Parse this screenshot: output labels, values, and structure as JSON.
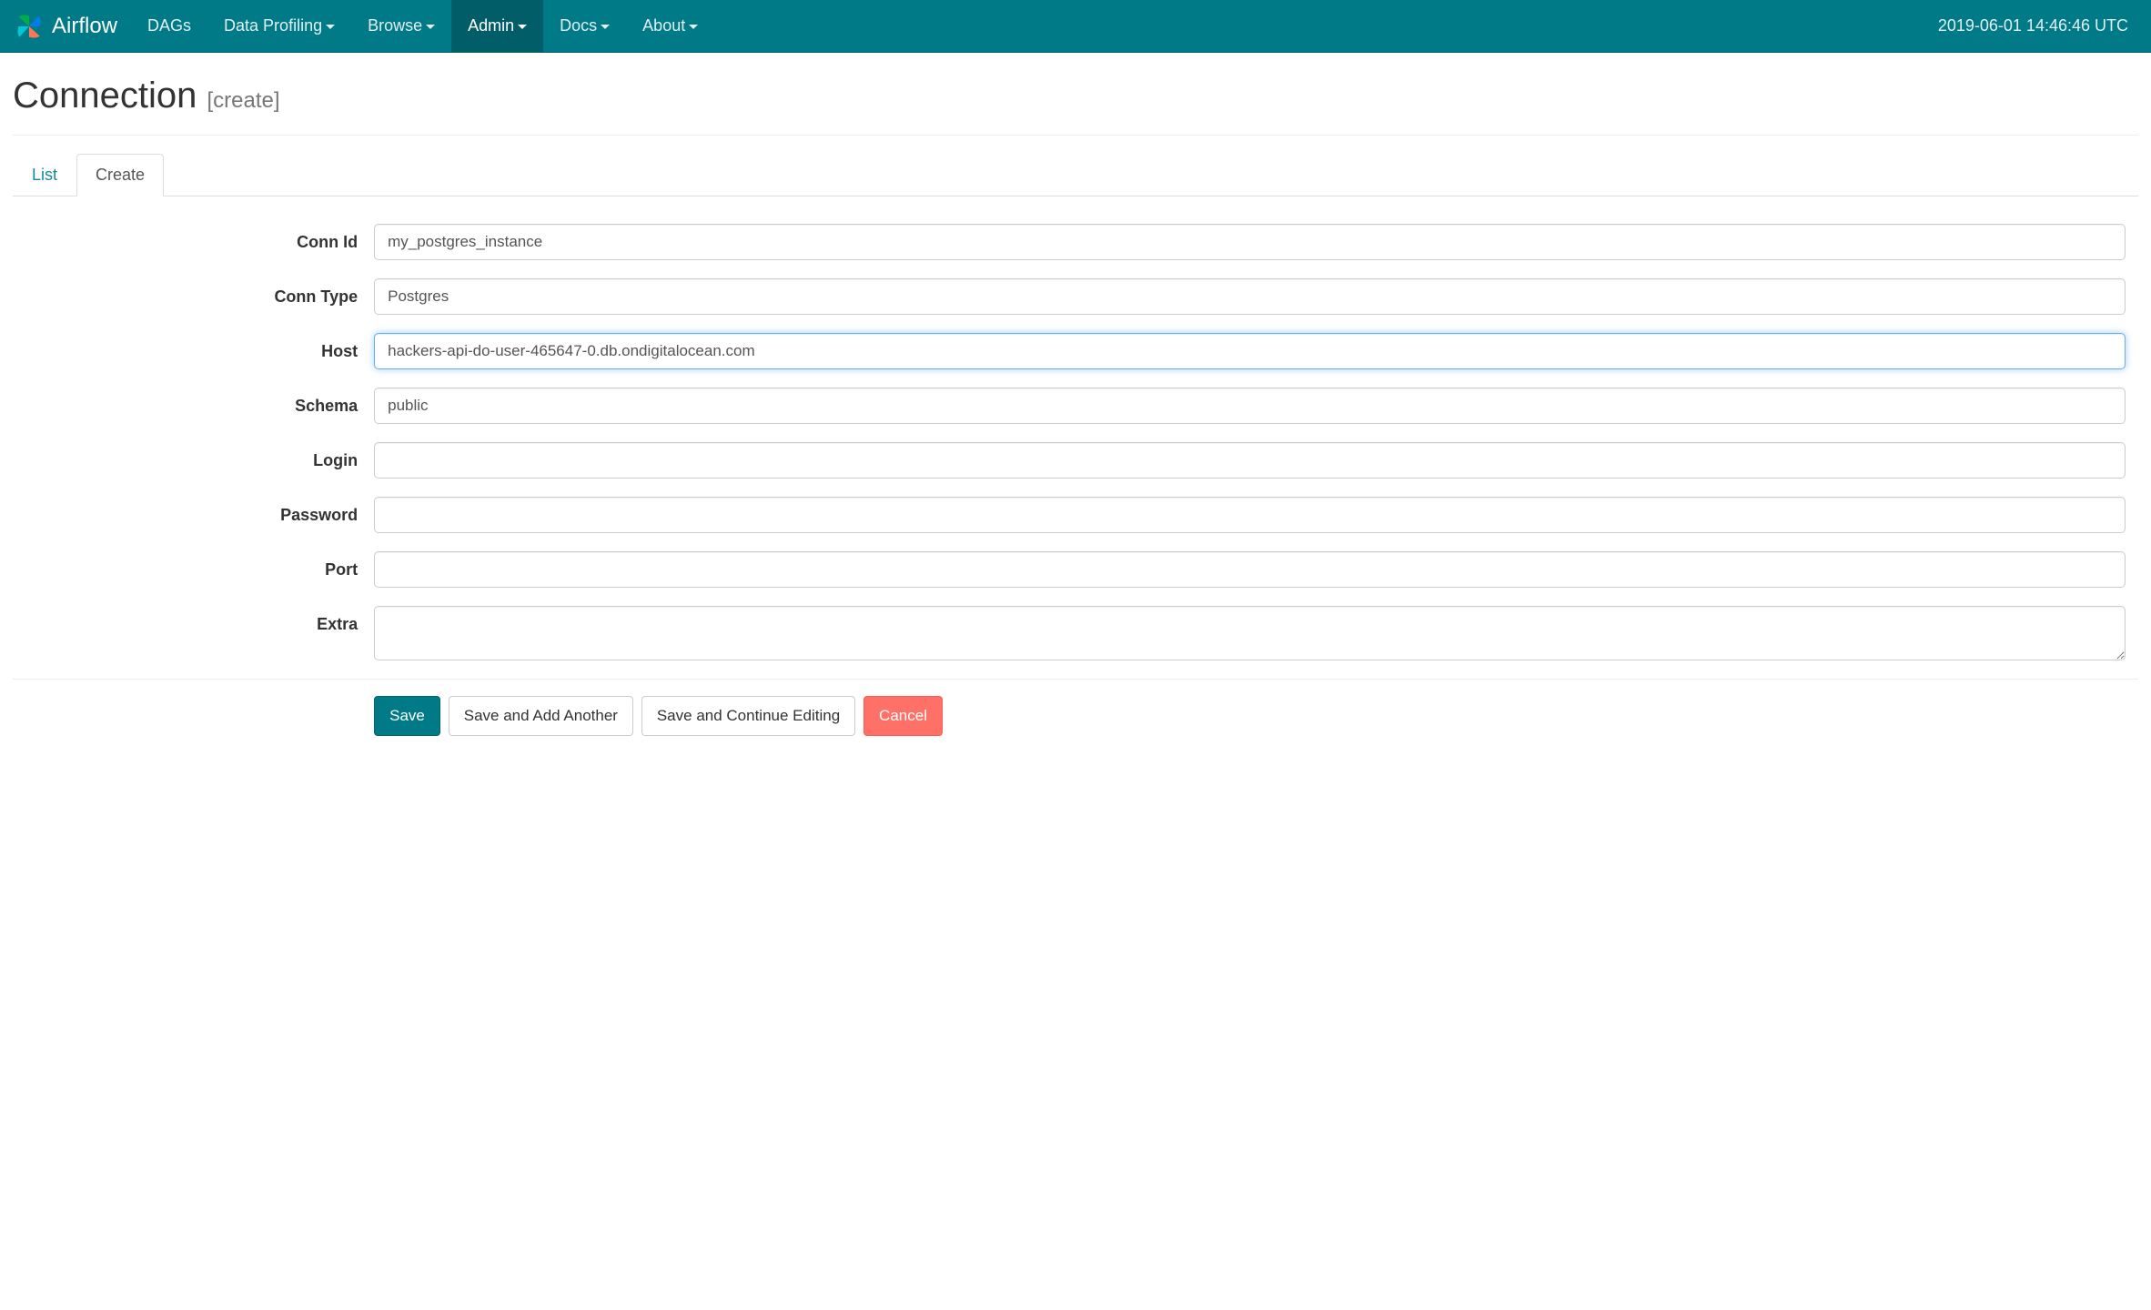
{
  "navbar": {
    "brand": "Airflow",
    "items": [
      {
        "label": "DAGs",
        "dropdown": false,
        "active": false
      },
      {
        "label": "Data Profiling",
        "dropdown": true,
        "active": false
      },
      {
        "label": "Browse",
        "dropdown": true,
        "active": false
      },
      {
        "label": "Admin",
        "dropdown": true,
        "active": true
      },
      {
        "label": "Docs",
        "dropdown": true,
        "active": false
      },
      {
        "label": "About",
        "dropdown": true,
        "active": false
      }
    ],
    "clock": "2019-06-01 14:46:46 UTC"
  },
  "page": {
    "title": "Connection",
    "subtitle": "[create]"
  },
  "tabs": {
    "list": "List",
    "create": "Create"
  },
  "form": {
    "labels": {
      "conn_id": "Conn Id",
      "conn_type": "Conn Type",
      "host": "Host",
      "schema": "Schema",
      "login": "Login",
      "password": "Password",
      "port": "Port",
      "extra": "Extra"
    },
    "values": {
      "conn_id": "my_postgres_instance",
      "conn_type": "Postgres",
      "host": "hackers-api-do-user-465647-0.db.ondigitalocean.com",
      "schema": "public",
      "login": "",
      "password": "",
      "port": "",
      "extra": ""
    }
  },
  "buttons": {
    "save": "Save",
    "save_add": "Save and Add Another",
    "save_continue": "Save and Continue Editing",
    "cancel": "Cancel"
  }
}
